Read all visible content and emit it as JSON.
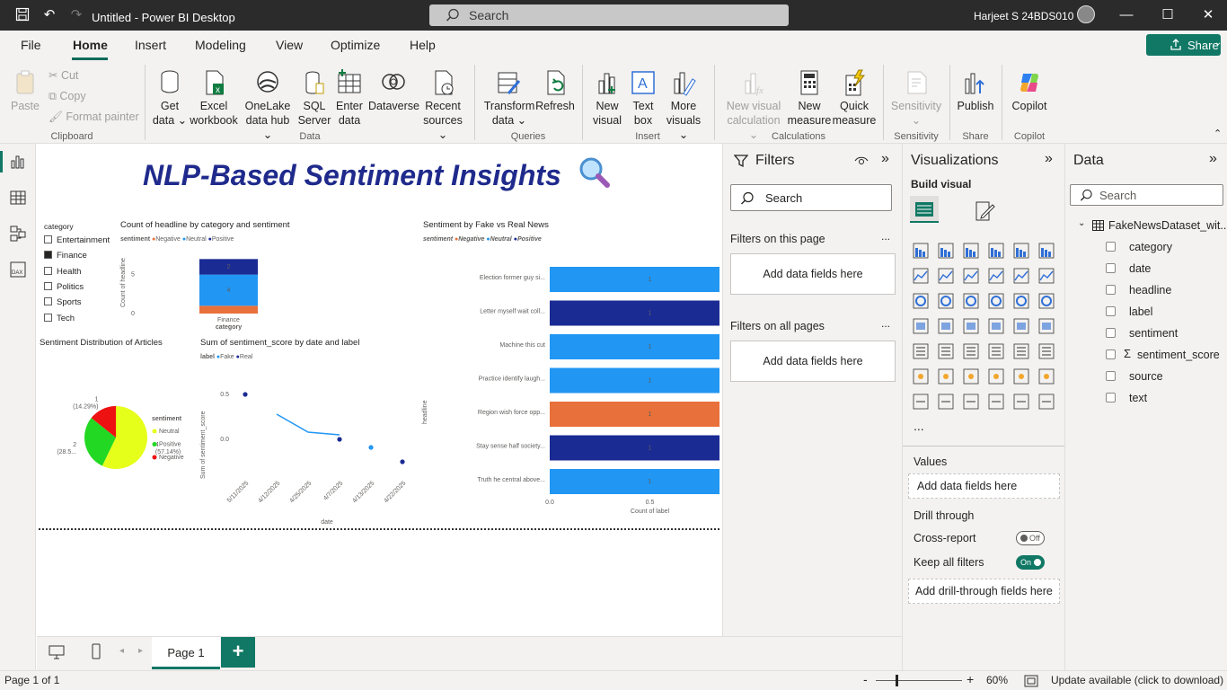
{
  "titlebar": {
    "title": "Untitled - Power BI Desktop",
    "search_placeholder": "Search",
    "user": "Harjeet S 24BDS010"
  },
  "menu": {
    "items": [
      "File",
      "Home",
      "Insert",
      "Modeling",
      "View",
      "Optimize",
      "Help"
    ],
    "active": "Home",
    "share": "Share"
  },
  "ribbon": {
    "clipboard": {
      "paste": "Paste",
      "cut": "Cut",
      "copy": "Copy",
      "format_painter": "Format painter",
      "label": "Clipboard"
    },
    "data": {
      "get_data": [
        "Get",
        "data ⌄"
      ],
      "excel": [
        "Excel",
        "workbook"
      ],
      "onelake": [
        "OneLake",
        "data hub ⌄"
      ],
      "sql": [
        "SQL",
        "Server"
      ],
      "enter": [
        "Enter",
        "data"
      ],
      "dataverse": [
        "Dataverse"
      ],
      "recent": [
        "Recent",
        "sources ⌄"
      ],
      "label": "Data"
    },
    "queries": {
      "transform": [
        "Transform",
        "data ⌄"
      ],
      "refresh": [
        "Refresh"
      ],
      "label": "Queries"
    },
    "insert": {
      "new_visual": [
        "New",
        "visual"
      ],
      "text_box": [
        "Text",
        "box"
      ],
      "more": [
        "More",
        "visuals ⌄"
      ],
      "label": "Insert"
    },
    "calculations": {
      "new_visual_calc": [
        "New visual",
        "calculation ⌄"
      ],
      "new_measure": [
        "New",
        "measure"
      ],
      "quick_measure": [
        "Quick",
        "measure"
      ],
      "label": "Calculations"
    },
    "sensitivity": {
      "btn": [
        "Sensitivity",
        "⌄"
      ],
      "label": "Sensitivity"
    },
    "share": {
      "publish": [
        "Publish"
      ],
      "label": "Share"
    },
    "copilot": {
      "btn": [
        "Copilot"
      ],
      "label": "Copilot"
    }
  },
  "report": {
    "title": "NLP-Based Sentiment Insights",
    "slicer": {
      "title": "category",
      "items": [
        {
          "label": "Entertainment",
          "checked": false
        },
        {
          "label": "Finance",
          "checked": true
        },
        {
          "label": "Health",
          "checked": false
        },
        {
          "label": "Politics",
          "checked": false
        },
        {
          "label": "Sports",
          "checked": false
        },
        {
          "label": "Tech",
          "checked": false
        }
      ]
    },
    "stacked_title": "Count of headline by category and sentiment",
    "stacked_legend_title": "sentiment",
    "stacked_legend": [
      "Negative",
      "Neutral",
      "Positive"
    ],
    "stacked_ylabel": "Count of headline",
    "stacked_xlabel": "category",
    "fake_real_title": "Sentiment by Fake vs Real News",
    "fake_real_legend_title": "sentiment",
    "fake_real_legend": [
      "Negative",
      "Neutral",
      "Positive"
    ],
    "fake_real_ylabel": "headline",
    "fake_real_xlabel": "Count of label",
    "pie_title": "Sentiment Distribution of Articles",
    "pie_legend_title": "sentiment",
    "pie_legend": [
      "Neutral",
      "Positive",
      "Negative"
    ],
    "line_title": "Sum of sentiment_score by date and label",
    "line_legend_title": "label",
    "line_legend": [
      "Fake",
      "Real"
    ],
    "line_ylabel": "Sum of sentiment_score",
    "line_xlabel": "date"
  },
  "colors": {
    "negative": "#e8703a",
    "neutral": "#2196f3",
    "positive": "#1a2b94",
    "pie_neutral": "#e6ff1a",
    "pie_positive": "#22d822",
    "pie_negative": "#ee1111",
    "accent": "#117865",
    "title": "#1f2a8c"
  },
  "chart_data": [
    {
      "type": "bar",
      "title": "Count of headline by category and sentiment",
      "categories": [
        "Finance"
      ],
      "series": [
        {
          "name": "Negative",
          "values": [
            1
          ]
        },
        {
          "name": "Neutral",
          "values": [
            4
          ]
        },
        {
          "name": "Positive",
          "values": [
            2
          ]
        }
      ],
      "stacked": true,
      "xlabel": "category",
      "ylabel": "Count of headline",
      "yticks": [
        "0",
        "5"
      ],
      "ylim": [
        0,
        7.5
      ]
    },
    {
      "type": "bar",
      "orientation": "horizontal",
      "title": "Sentiment by Fake vs Real News",
      "categories": [
        "Election former guy si...",
        "Letter myself wait coll...",
        "Machine this cut",
        "Practice identify laugh...",
        "Region wish force opp...",
        "Stay sense half society...",
        "Truth he central above..."
      ],
      "values": [
        1,
        1,
        1,
        1,
        1,
        1,
        1
      ],
      "sentiments": [
        "Neutral",
        "Positive",
        "Neutral",
        "Neutral",
        "Negative",
        "Positive",
        "Neutral"
      ],
      "xlabel": "Count of label",
      "ylabel": "headline",
      "xticks": [
        "0.0",
        "0.5",
        "1.0"
      ],
      "xlim": [
        0,
        1
      ]
    },
    {
      "type": "pie",
      "title": "Sentiment Distribution of Articles",
      "slices": [
        {
          "label": "Neutral",
          "value": 4,
          "data_label": "4",
          "pct_label": "(57.14%)"
        },
        {
          "label": "Positive",
          "value": 2,
          "data_label": "2",
          "pct_label": "(28.5..."
        },
        {
          "label": "Negative",
          "value": 1,
          "data_label": "1",
          "pct_label": "(14.29%)"
        }
      ]
    },
    {
      "type": "line",
      "title": "Sum of sentiment_score by date and label",
      "x": [
        "5/11/2025",
        "4/12/2025",
        "4/25/2025",
        "4/7/2025",
        "4/13/2025",
        "4/22/2025"
      ],
      "series": [
        {
          "name": "Fake",
          "values": [
            null,
            0.28,
            0.08,
            0.05,
            null,
            null
          ]
        },
        {
          "name": "Real",
          "values": [
            0.5,
            null,
            null,
            0.0,
            null,
            -0.25
          ]
        },
        {
          "name": "Fake",
          "values": [
            null,
            null,
            null,
            null,
            -0.09,
            null
          ]
        }
      ],
      "xlabel": "date",
      "ylabel": "Sum of sentiment_score",
      "yticks": [
        "0.5",
        "0.0"
      ],
      "ylim": [
        -0.3,
        0.6
      ]
    }
  ],
  "filters": {
    "title": "Filters",
    "search": "Search",
    "on_page": "Filters on this page",
    "on_all": "Filters on all pages",
    "add": "Add data fields here",
    "more": "..."
  },
  "viz": {
    "title": "Visualizations",
    "build": "Build visual",
    "more": "...",
    "values": "Values",
    "add_values": "Add data fields here",
    "drill": "Drill through",
    "cross_report": "Cross-report",
    "cross_state": "Off",
    "keep_filters": "Keep all filters",
    "keep_state": "On",
    "add_drill": "Add drill-through fields here"
  },
  "datapane": {
    "title": "Data",
    "search": "Search",
    "table": "FakeNewsDataset_wit...",
    "fields": [
      {
        "label": "category",
        "sigma": false
      },
      {
        "label": "date",
        "sigma": false
      },
      {
        "label": "headline",
        "sigma": false
      },
      {
        "label": "label",
        "sigma": false
      },
      {
        "label": "sentiment",
        "sigma": false
      },
      {
        "label": "sentiment_score",
        "sigma": true
      },
      {
        "label": "source",
        "sigma": false
      },
      {
        "label": "text",
        "sigma": false
      }
    ]
  },
  "tabs": {
    "page": "Page 1",
    "add": "+"
  },
  "status": {
    "page_of": "Page 1 of 1",
    "zoom": "60%",
    "update": "Update available (click to download)"
  }
}
